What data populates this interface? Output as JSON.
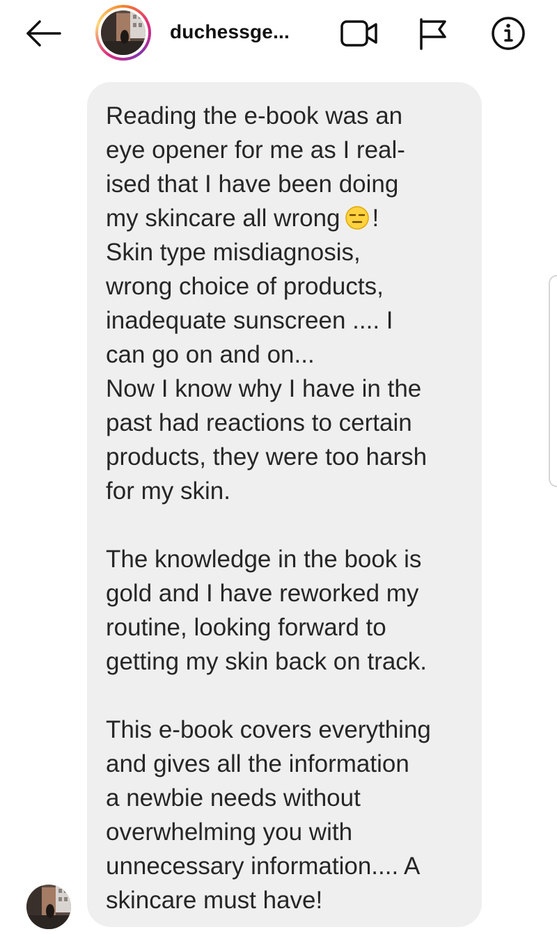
{
  "header": {
    "username": "duchessge...",
    "icons": {
      "back": "arrow-left-icon",
      "video": "video-camera-icon",
      "flag": "flag-icon",
      "info": "info-icon"
    }
  },
  "message": {
    "lines": [
      "Reading the e-book was an",
      "eye opener for me as I real-",
      "ised that I have been doing",
      "my skincare all wrong",
      "Skin type misdiagnosis,",
      "wrong choice of products,",
      "inadequate sunscreen .... I",
      "can go on and on...",
      "Now I know why I have in the",
      "past had reactions to certain",
      "products, they were too harsh",
      "for my skin.",
      "",
      "The knowledge in the book is",
      "gold and I have reworked my",
      "routine, looking forward to",
      "getting my skin back on track.",
      "",
      "This e-book covers everything",
      "and gives all the information",
      "a newbie needs without",
      "overwhelming you with",
      "unnecessary information.... A",
      "skincare must have!"
    ],
    "emoji_suffix": "!",
    "emoji_name": "expressionless-face-emoji"
  },
  "colors": {
    "bubble": "#efefef",
    "text": "#262626",
    "ring_start": "#f58529",
    "ring_mid": "#dd2a7b",
    "ring_end": "#8134af"
  }
}
